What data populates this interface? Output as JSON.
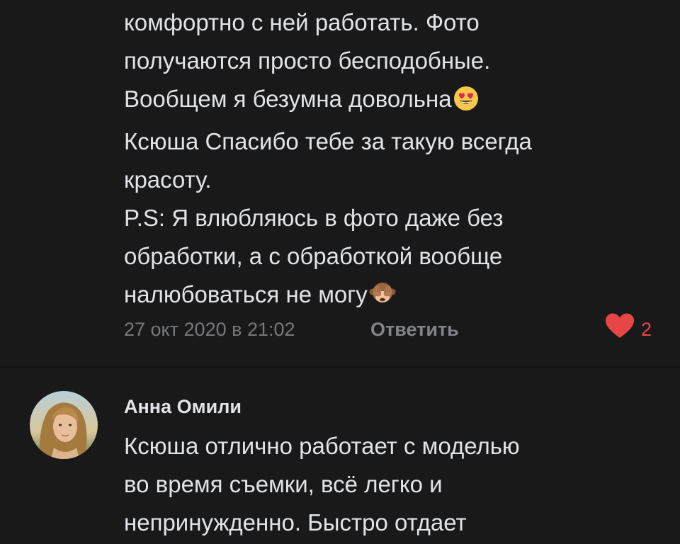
{
  "comments": [
    {
      "text_lines": [
        "комфортно с ней работать. Фото",
        "получаются просто бесподобные.",
        "Вообщем я безумна довольна",
        "Ксюша Спасибо тебе за такую всегда",
        "красоту.",
        "P.S: Я влюбляюсь в фото даже без",
        "обработки, а с обработкой вообще",
        "налюбоваться не могу"
      ],
      "emojis": [
        "smiling-face-with-heart-eyes-icon",
        "see-no-evil-monkey-icon"
      ],
      "date": "27 окт 2020 в 21:02",
      "reply_label": "Ответить",
      "like_count": "2",
      "like_color": "#e64646"
    },
    {
      "author": "Анна Омили",
      "avatar": "user-photo-avatar",
      "text_lines": [
        "Ксюша отлично работает с моделью",
        "во время съемки, всё легко и",
        "непринужденно. Быстро отдает"
      ]
    }
  ],
  "colors": {
    "background": "#19191a",
    "text_primary": "#e1e3e6",
    "text_secondary": "#76787a",
    "like_accent": "#e64646"
  }
}
